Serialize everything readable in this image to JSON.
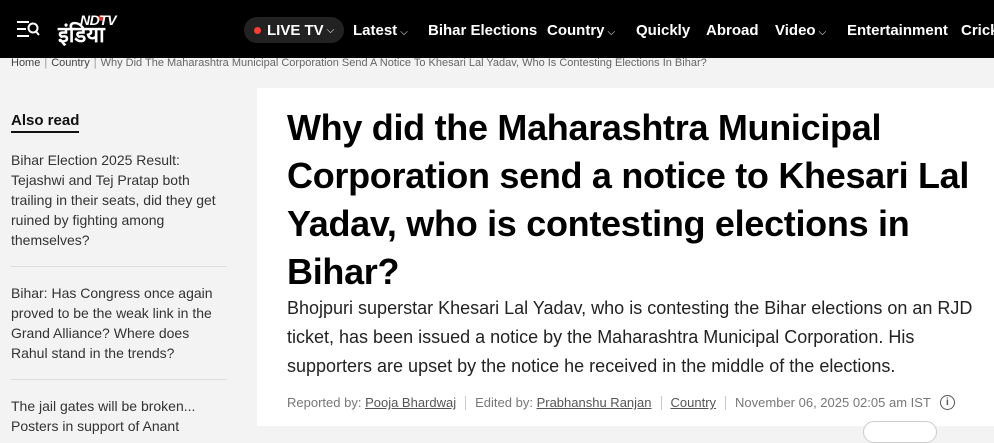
{
  "header": {
    "logo_top": "NDTV",
    "logo_main": "इंडिया",
    "live_label": "LIVE TV",
    "nav": [
      {
        "label": "Latest",
        "dropdown": true
      },
      {
        "label": "Bihar Elections",
        "dropdown": false
      },
      {
        "label": "Country",
        "dropdown": true
      },
      {
        "label": "Quickly",
        "dropdown": false
      },
      {
        "label": "Abroad",
        "dropdown": false
      },
      {
        "label": "Video",
        "dropdown": true
      },
      {
        "label": "Entertainment",
        "dropdown": false
      },
      {
        "label": "Crick",
        "dropdown": false
      }
    ]
  },
  "breadcrumb": {
    "home": "Home",
    "section": "Country",
    "current": "Why Did The Maharashtra Municipal Corporation Send A Notice To Khesari Lal Yadav, Who Is Contesting Elections In Bihar?"
  },
  "sidebar": {
    "title": "Also read",
    "items": [
      {
        "text": "Bihar Election 2025 Result: Tejashwi and Tej Pratap both trailing in their seats, did they get ruined by fighting among themselves?"
      },
      {
        "text": "Bihar: Has Congress once again proved to be the weak link in the Grand Alliance? Where does Rahul stand in the trends?"
      },
      {
        "text": "The jail gates will be broken... Posters in support of Anant"
      }
    ]
  },
  "article": {
    "headline": "Why did the Maharashtra Municipal Corporation send a notice to Khesari Lal Yadav, who is contesting elections in Bihar?",
    "summary": "Bhojpuri superstar Khesari Lal Yadav, who is contesting the Bihar elections on an RJD ticket, has been issued a notice by the Maharashtra Municipal Corporation. His supporters are upset by the notice he received in the middle of the elections.",
    "meta": {
      "reported_label": "Reported by:",
      "reporter": "Pooja Bhardwaj",
      "edited_label": "Edited by:",
      "editor": "Prabhanshu Ranjan",
      "category": "Country",
      "timestamp": "November 06, 2025 02:05 am IST"
    }
  },
  "colors": {
    "topbar": "#000000",
    "live_dot": "#ff3b30",
    "page_bg": "#f3f3f3"
  }
}
